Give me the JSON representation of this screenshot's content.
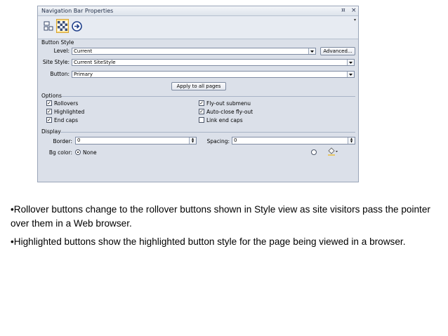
{
  "window": {
    "title": "Navigation Bar Properties",
    "pin_glyph": "¤",
    "close_glyph": "×"
  },
  "toolbar": {
    "items": [
      {
        "icon": "general-layout-icon",
        "active": false
      },
      {
        "icon": "button-style-icon",
        "active": true
      },
      {
        "icon": "navigation-arrow-icon",
        "active": false
      }
    ]
  },
  "button_style": {
    "group_label": "Button Style",
    "level": {
      "label_pre": "Level:",
      "value": "Current"
    },
    "advanced_button": "Advanced...",
    "site_style": {
      "label_pre": "Site Style:",
      "value": "Current SiteStyle"
    },
    "button": {
      "label_pre": "Button:",
      "value": "Primary"
    },
    "apply_button": "Apply to all pages"
  },
  "options": {
    "group_label": "Options",
    "left": [
      {
        "label": "Rollovers",
        "checked": true
      },
      {
        "label": "Highlighted",
        "checked": true
      },
      {
        "label": "End caps",
        "checked": true
      }
    ],
    "right": [
      {
        "label": "Fly-out submenu",
        "checked": true
      },
      {
        "label": "Auto-close fly-out",
        "checked": true
      },
      {
        "label": "Link end caps",
        "checked": false
      }
    ]
  },
  "display": {
    "group_label": "Display",
    "border": {
      "label": "Border:",
      "value": "0"
    },
    "spacing": {
      "label": "Spacing:",
      "value": "0"
    },
    "bg_color": {
      "label": "Bg color:",
      "option": "None",
      "selected": true
    }
  },
  "bullets": [
    "•Rollover buttons change to the rollover buttons shown in Style view as site visitors pass the pointer over them in a Web browser.",
    "•Highlighted buttons show the highlighted button style for the page being viewed in a browser."
  ]
}
